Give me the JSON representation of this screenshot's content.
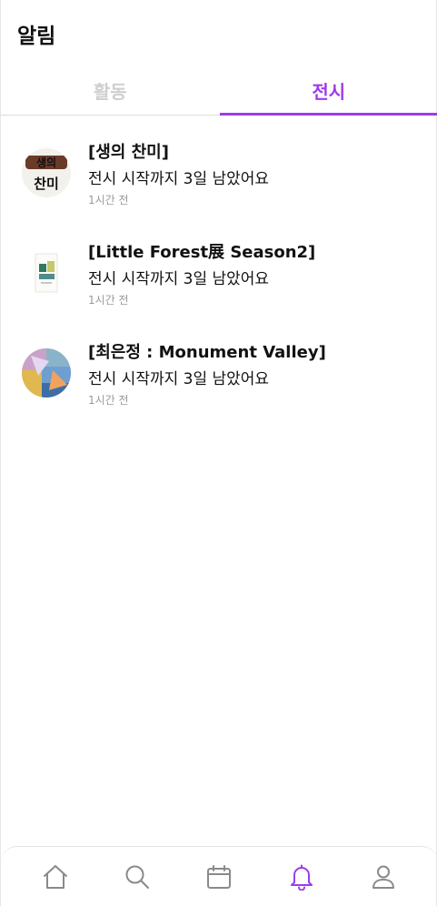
{
  "header": {
    "title": "알림"
  },
  "tabs": [
    {
      "label": "활동",
      "active": false
    },
    {
      "label": "전시",
      "active": true
    }
  ],
  "notifications": [
    {
      "title": "[생의 찬미]",
      "message": "전시 시작까지 3일 남았어요",
      "time": "1시간 전",
      "thumb_icon": "exhibition-poster-thumbnail"
    },
    {
      "title": "[Little Forest展 Season2]",
      "message": "전시 시작까지 3일 남았어요",
      "time": "1시간 전",
      "thumb_icon": "exhibition-poster-thumbnail"
    },
    {
      "title": "[최은정 : Monument Valley]",
      "message": "전시 시작까지 3일 남았어요",
      "time": "1시간 전",
      "thumb_icon": "exhibition-painting-thumbnail"
    }
  ],
  "bottom_nav": {
    "items": [
      "home-icon",
      "search-icon",
      "calendar-icon",
      "bell-icon",
      "profile-icon"
    ],
    "active": "bell-icon"
  },
  "colors": {
    "accent": "#9f3bea",
    "inactive_tab": "#cfcfcf",
    "icon_gray": "#8a8a8a",
    "time_gray": "#9a9a9a"
  }
}
